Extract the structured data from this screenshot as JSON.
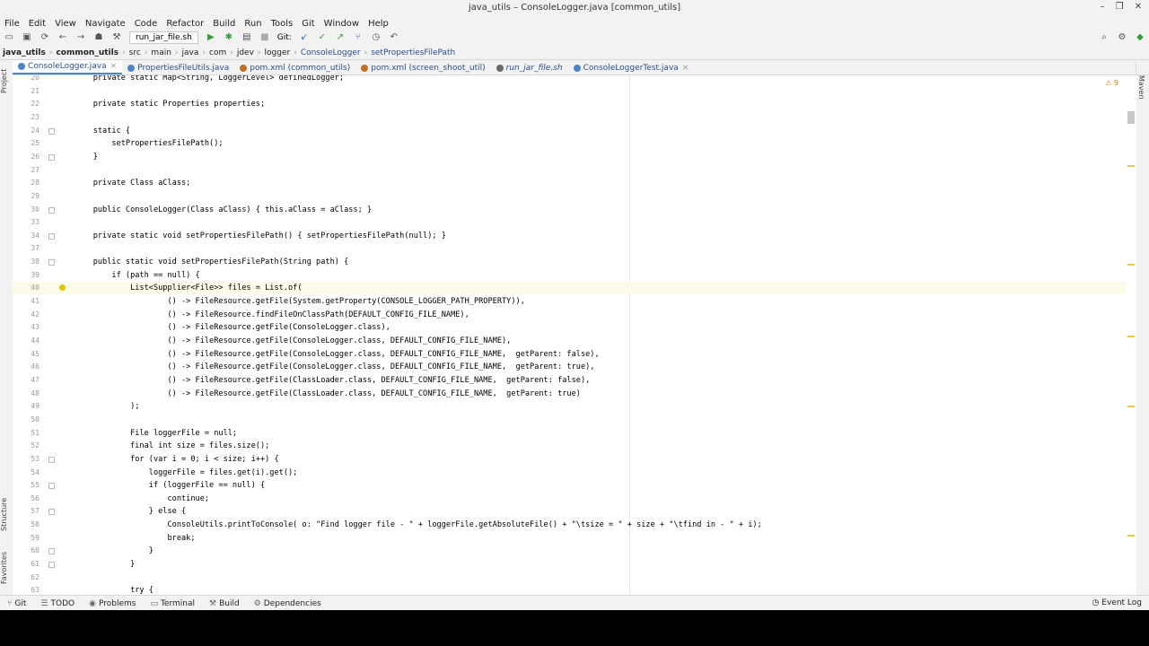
{
  "window": {
    "title": "java_utils – ConsoleLogger.java [common_utils]"
  },
  "menu": [
    "File",
    "Edit",
    "View",
    "Navigate",
    "Code",
    "Refactor",
    "Build",
    "Run",
    "Tools",
    "Git",
    "Window",
    "Help"
  ],
  "toolbar": {
    "run_config": "run_jar_file.sh",
    "git_label": "Git:"
  },
  "breadcrumbs": [
    "java_utils",
    "common_utils",
    "src",
    "main",
    "java",
    "com",
    "jdev",
    "logger",
    "ConsoleLogger",
    "setPropertiesFilePath"
  ],
  "tabs": [
    {
      "label": "ConsoleLogger.java",
      "active": true,
      "italic": false,
      "color": "#4a86c8"
    },
    {
      "label": "PropertiesFileUtils.java",
      "active": false,
      "italic": false,
      "color": "#4a86c8"
    },
    {
      "label": "pom.xml (common_utils)",
      "active": false,
      "italic": false,
      "color": "#c07020"
    },
    {
      "label": "pom.xml (screen_shoot_util)",
      "active": false,
      "italic": false,
      "color": "#c07020"
    },
    {
      "label": "run_jar_file.sh",
      "active": false,
      "italic": true,
      "color": "#6a6a6a"
    },
    {
      "label": "ConsoleLoggerTest.java",
      "active": false,
      "italic": false,
      "color": "#4a86c8"
    }
  ],
  "side_left": [
    "Project",
    "Structure",
    "Favorites"
  ],
  "side_right": [
    "Maven"
  ],
  "warnings": "⚠ 9",
  "code_lines": [
    {
      "n": "20",
      "t": "    private static Map<String, LoggerLevel> definedLogger;"
    },
    {
      "n": "21",
      "t": ""
    },
    {
      "n": "22",
      "t": "    private static Properties properties;"
    },
    {
      "n": "23",
      "t": ""
    },
    {
      "n": "24",
      "t": "    static {"
    },
    {
      "n": "25",
      "t": "        setPropertiesFilePath();"
    },
    {
      "n": "26",
      "t": "    }"
    },
    {
      "n": "27",
      "t": ""
    },
    {
      "n": "28",
      "t": "    private Class aClass;"
    },
    {
      "n": "29",
      "t": ""
    },
    {
      "n": "30",
      "t": "    public ConsoleLogger(Class aClass) { this.aClass = aClass; }"
    },
    {
      "n": "33",
      "t": ""
    },
    {
      "n": "34",
      "t": "    private static void setPropertiesFilePath() { setPropertiesFilePath(null); }"
    },
    {
      "n": "37",
      "t": ""
    },
    {
      "n": "38",
      "t": "    public static void setPropertiesFilePath(String path) {"
    },
    {
      "n": "39",
      "t": "        if (path == null) {"
    },
    {
      "n": "40",
      "t": "            List<Supplier<File>> files = List.of("
    },
    {
      "n": "41",
      "t": "                    () -> FileResource.getFile(System.getProperty(CONSOLE_LOGGER_PATH_PROPERTY)),"
    },
    {
      "n": "42",
      "t": "                    () -> FileResource.findFileOnClassPath(DEFAULT_CONFIG_FILE_NAME),"
    },
    {
      "n": "43",
      "t": "                    () -> FileResource.getFile(ConsoleLogger.class),"
    },
    {
      "n": "44",
      "t": "                    () -> FileResource.getFile(ConsoleLogger.class, DEFAULT_CONFIG_FILE_NAME),"
    },
    {
      "n": "45",
      "t": "                    () -> FileResource.getFile(ConsoleLogger.class, DEFAULT_CONFIG_FILE_NAME,  getParent: false),"
    },
    {
      "n": "46",
      "t": "                    () -> FileResource.getFile(ConsoleLogger.class, DEFAULT_CONFIG_FILE_NAME,  getParent: true),"
    },
    {
      "n": "47",
      "t": "                    () -> FileResource.getFile(ClassLoader.class, DEFAULT_CONFIG_FILE_NAME,  getParent: false),"
    },
    {
      "n": "48",
      "t": "                    () -> FileResource.getFile(ClassLoader.class, DEFAULT_CONFIG_FILE_NAME,  getParent: true)"
    },
    {
      "n": "49",
      "t": "            );"
    },
    {
      "n": "50",
      "t": ""
    },
    {
      "n": "51",
      "t": "            File loggerFile = null;"
    },
    {
      "n": "52",
      "t": "            final int size = files.size();"
    },
    {
      "n": "53",
      "t": "            for (var i = 0; i < size; i++) {"
    },
    {
      "n": "54",
      "t": "                loggerFile = files.get(i).get();"
    },
    {
      "n": "55",
      "t": "                if (loggerFile == null) {"
    },
    {
      "n": "56",
      "t": "                    continue;"
    },
    {
      "n": "57",
      "t": "                } else {"
    },
    {
      "n": "58",
      "t": "                    ConsoleUtils.printToConsole( o: \"Find logger file - \" + loggerFile.getAbsoluteFile() + \"\\tsize = \" + size + \"\\tfind in - \" + i);"
    },
    {
      "n": "59",
      "t": "                    break;"
    },
    {
      "n": "60",
      "t": "                }"
    },
    {
      "n": "61",
      "t": "            }"
    },
    {
      "n": "62",
      "t": ""
    },
    {
      "n": "63",
      "t": "            try {"
    }
  ],
  "status": [
    "Git",
    "TODO",
    "Problems",
    "Terminal",
    "Build",
    "Dependencies"
  ],
  "event_log": "Event Log"
}
